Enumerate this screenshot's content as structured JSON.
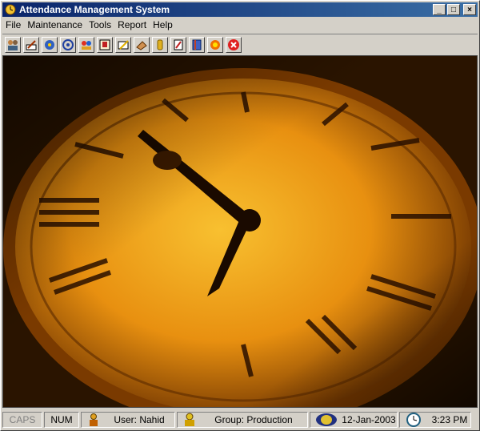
{
  "window": {
    "title": "Attendance Management System"
  },
  "titlebar_buttons": {
    "minimize": "_",
    "maximize": "□",
    "close": "×"
  },
  "menu": [
    {
      "label": "File"
    },
    {
      "label": "Maintenance"
    },
    {
      "label": "Tools"
    },
    {
      "label": "Report"
    },
    {
      "label": "Help"
    }
  ],
  "toolbar": {
    "icons": [
      "users-icon",
      "edit-icon",
      "settings-icon",
      "target-icon",
      "group-icon",
      "id-card-icon",
      "pencil-icon",
      "eraser-icon",
      "timer-icon",
      "report-icon",
      "book-icon",
      "sun-icon",
      "exit-icon"
    ]
  },
  "status": {
    "caps": "CAPS",
    "num": "NUM",
    "user": "User: Nahid",
    "group": "Group: Production",
    "date": "12-Jan-2003",
    "time": "3:23 PM"
  },
  "colors": {
    "titlebar_start": "#0a246a",
    "titlebar_end": "#3a6ea5",
    "background": "#d4d0c8",
    "clock_face": "#f0a818"
  }
}
